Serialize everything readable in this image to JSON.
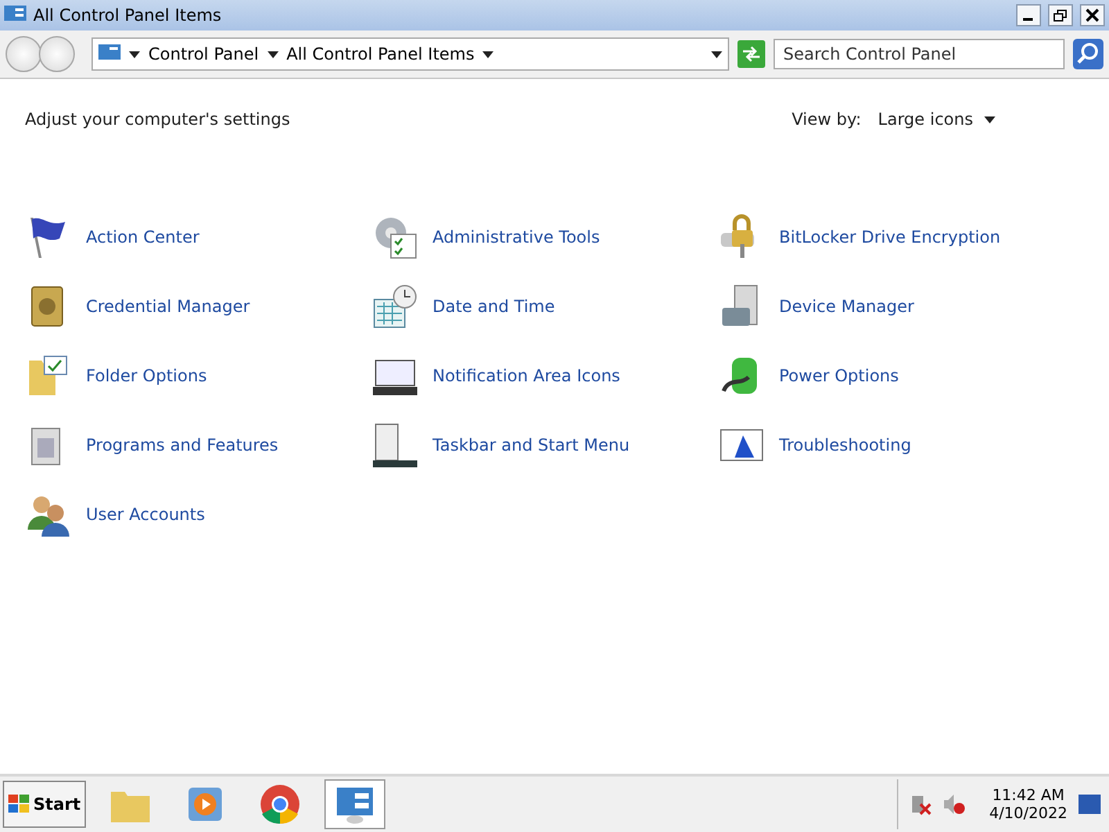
{
  "window": {
    "title": "All Control Panel Items"
  },
  "address_bar": {
    "breadcrumbs": [
      "Control Panel",
      "All Control Panel Items"
    ]
  },
  "search": {
    "placeholder": "Search Control Panel"
  },
  "header": {
    "heading": "Adjust your computer's settings",
    "view_by_label": "View by:",
    "view_by_value": "Large icons"
  },
  "items": [
    {
      "label": "Action Center",
      "kind": "flag"
    },
    {
      "label": "Administrative Tools",
      "kind": "gear"
    },
    {
      "label": "BitLocker Drive Encryption",
      "kind": "lock"
    },
    {
      "label": "Credential Manager",
      "kind": "safe"
    },
    {
      "label": "Date and Time",
      "kind": "calendar"
    },
    {
      "label": "Device Manager",
      "kind": "toolbox"
    },
    {
      "label": "Folder Options",
      "kind": "folder"
    },
    {
      "label": "Notification Area Icons",
      "kind": "monitor"
    },
    {
      "label": "Power Options",
      "kind": "battery"
    },
    {
      "label": "Programs and Features",
      "kind": "programs"
    },
    {
      "label": "Taskbar and Start Menu",
      "kind": "taskbar"
    },
    {
      "label": "Troubleshooting",
      "kind": "screen"
    },
    {
      "label": "User Accounts",
      "kind": "users"
    }
  ],
  "taskbar": {
    "start_label": "Start",
    "apps": [
      {
        "kind": "explorer",
        "selected": false
      },
      {
        "kind": "media",
        "selected": false
      },
      {
        "kind": "browser",
        "selected": false
      },
      {
        "kind": "control",
        "selected": true
      }
    ],
    "clock": {
      "time": "11:42 AM",
      "date": "4/10/2022"
    }
  }
}
